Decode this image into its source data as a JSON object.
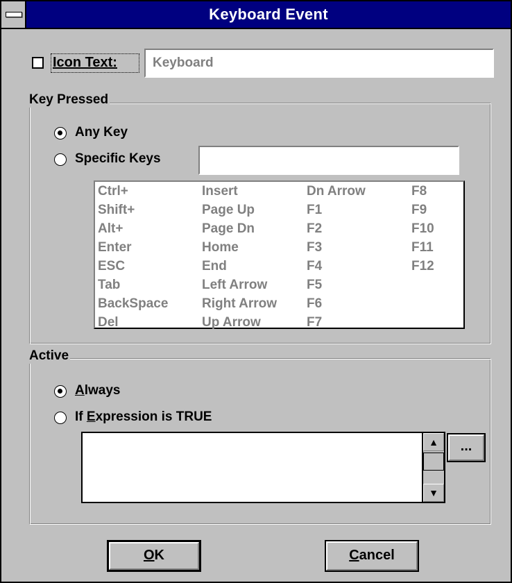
{
  "window": {
    "title": "Keyboard Event"
  },
  "icon_text": {
    "checked": false,
    "label": "Icon Text:",
    "value": "Keyboard"
  },
  "key_pressed": {
    "group_label": "Key Pressed",
    "any_key_label": "Any Key",
    "any_key_selected": true,
    "specific_keys_label": "Specific Keys",
    "specific_keys_value": "",
    "key_columns": [
      [
        "Ctrl+",
        "Shift+",
        "Alt+",
        "Enter",
        "ESC",
        "Tab",
        "BackSpace",
        "Del"
      ],
      [
        "Insert",
        "Page Up",
        "Page Dn",
        "Home",
        "End",
        "Left Arrow",
        "Right Arrow",
        "Up Arrow"
      ],
      [
        "Dn Arrow",
        "F1",
        "F2",
        "F3",
        "F4",
        "F5",
        "F6",
        "F7"
      ],
      [
        "F8",
        "F9",
        "F10",
        "F11",
        "F12"
      ]
    ]
  },
  "active": {
    "group_label": "Active",
    "always_label": "Always",
    "always_selected": true,
    "if_expr_label": "If Expression is TRUE",
    "expression_value": "",
    "ellipsis_label": "..."
  },
  "buttons": {
    "ok_label": "OK",
    "cancel_label": "Cancel"
  }
}
